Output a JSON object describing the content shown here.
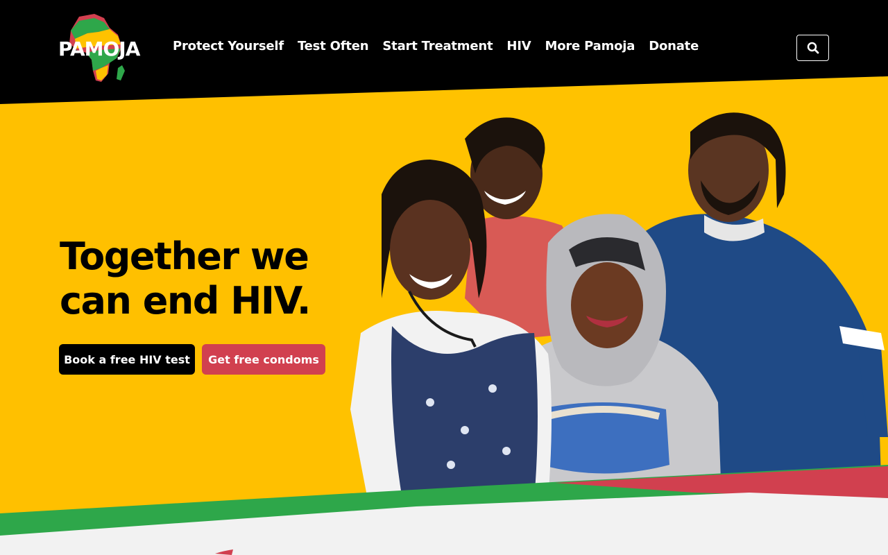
{
  "brand": {
    "name": "PAMOJA"
  },
  "nav": {
    "items": [
      {
        "label": "Protect Yourself"
      },
      {
        "label": "Test Often"
      },
      {
        "label": "Start Treatment"
      },
      {
        "label": "HIV"
      },
      {
        "label": "More Pamoja"
      },
      {
        "label": "Donate"
      }
    ]
  },
  "search": {
    "icon": "search-icon"
  },
  "hero": {
    "title_line1": "Together we",
    "title_line2": "can end HIV.",
    "primary_button": "Book a free HIV test",
    "secondary_button": "Get free condoms"
  },
  "colors": {
    "header_bg": "#000000",
    "hero_yellow": "#ffc200",
    "accent_red": "#d1404f",
    "accent_green": "#2ea74a",
    "page_bg": "#f2f2f2"
  }
}
